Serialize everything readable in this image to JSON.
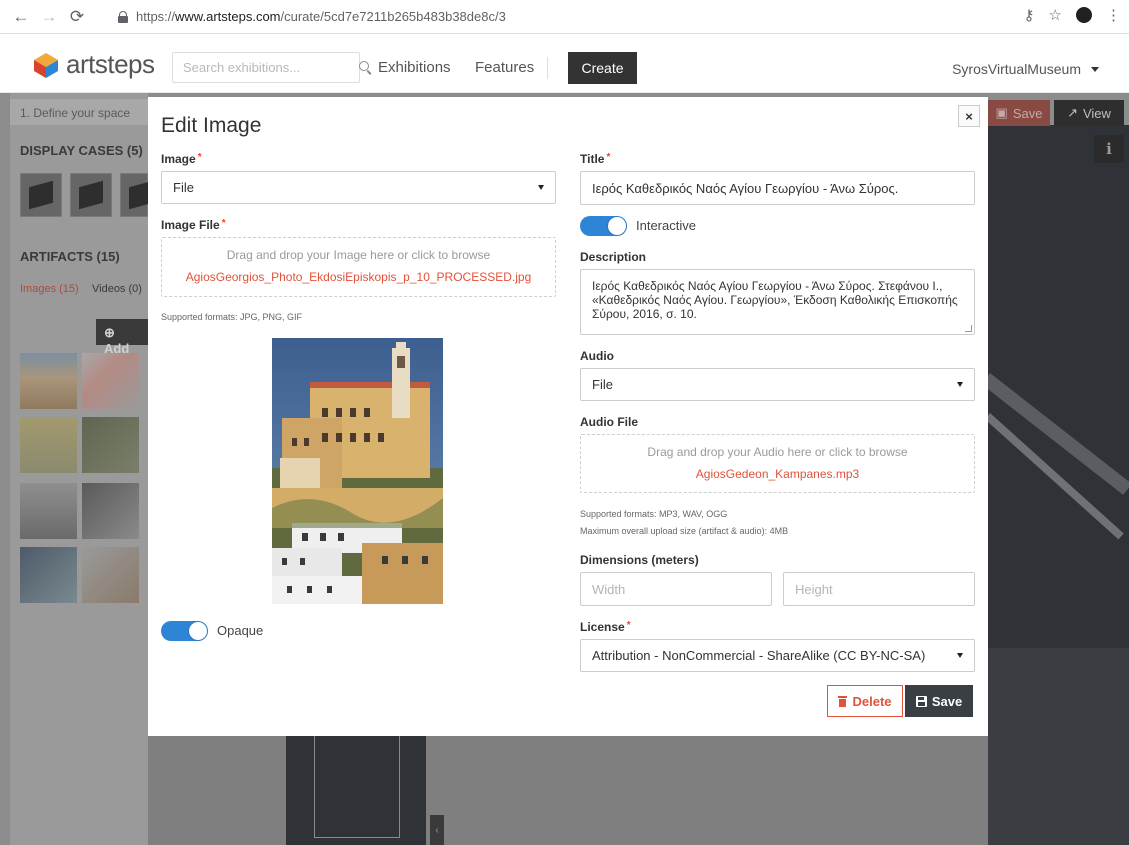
{
  "browser": {
    "url_scheme": "https://",
    "url_host": "www.artsteps.com",
    "url_path": "/curate/5cd7e7211b265b483b38de8c/3"
  },
  "header": {
    "logo_text": "artsteps",
    "search_placeholder": "Search exhibitions...",
    "nav_exhibitions": "Exhibitions",
    "nav_features": "Features",
    "create_label": "Create",
    "user_name": "SyrosVirtualMuseum"
  },
  "workspace": {
    "step_label": "1. Define your space",
    "display_cases": "DISPLAY CASES (5)",
    "artifacts": "ARTIFACTS (15)",
    "tab_images": "Images",
    "tab_images_count": "(15)",
    "tab_videos": "Videos",
    "tab_videos_count": "(0)",
    "add_label": "Add",
    "top_save_label": "Save",
    "top_view_label": "View"
  },
  "modal": {
    "title": "Edit Image",
    "image_label": "Image",
    "image_source_value": "File",
    "image_file_label": "Image File",
    "image_dropzone_hint": "Drag and drop your Image here or click to browse",
    "image_file_name": "AgiosGeorgios_Photo_EkdosiEpiskopis_p_10_PROCESSED.jpg",
    "image_formats": "Supported formats: JPG, PNG, GIF",
    "opaque_label": "Opaque",
    "title_label": "Title",
    "title_value": "Ιερός Καθεδρικός Ναός Αγίου Γεωργίου - Άνω Σύρος.",
    "interactive_label": "Interactive",
    "description_label": "Description",
    "description_value": "Ιερός Καθεδρικός Ναός Αγίου Γεωργίου - Άνω Σύρος. Στεφάνου Ι., «Καθεδρικός Ναός Αγίου. Γεωργίου», Έκδοση Καθολικής Επισκοπής Σύρου, 2016, σ. 10.",
    "audio_label": "Audio",
    "audio_source_value": "File",
    "audio_file_label": "Audio File",
    "audio_dropzone_hint": "Drag and drop your Audio here or click to browse",
    "audio_file_name": "AgiosGedeon_Kampanes.mp3",
    "audio_formats": "Supported formats: MP3, WAV, OGG",
    "upload_limit": "Maximum overall upload size (artifact & audio): 4MB",
    "dimensions_label": "Dimensions (meters)",
    "width_placeholder": "Width",
    "height_placeholder": "Height",
    "license_label": "License",
    "license_value": "Attribution - NonCommercial - ShareAlike (CC BY-NC-SA)",
    "delete_label": "Delete",
    "save_label": "Save",
    "required_mark": "*",
    "close_glyph": "×"
  },
  "colors": {
    "accent_blue": "#2e85d6",
    "danger_red": "#e0533a",
    "dark_button": "#3a3f44"
  }
}
